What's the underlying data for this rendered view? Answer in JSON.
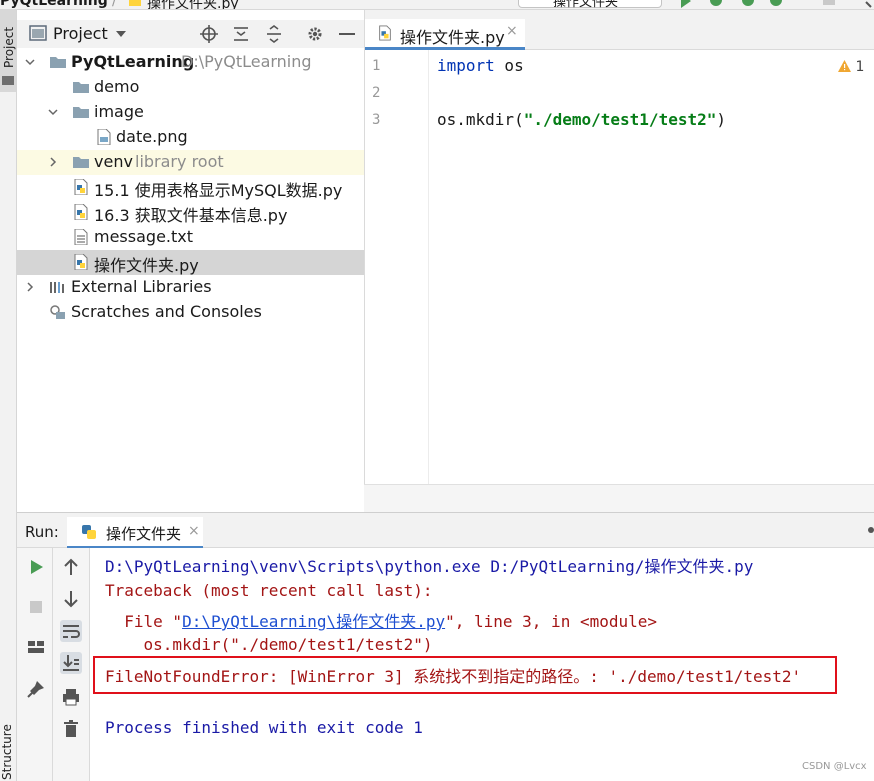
{
  "nav": {
    "root": "PyQtLearning",
    "separator": "/",
    "file": "操作文件夹.py",
    "run_config": "操作文件夹"
  },
  "left_strip": {
    "project": "Project",
    "structure": "Structure"
  },
  "project_panel": {
    "title": "Project",
    "tree": [
      {
        "label": "PyQtLearning",
        "sub": "D:\\PyQtLearning",
        "icon": "folder-icon"
      },
      {
        "label": "demo",
        "icon": "folder-icon"
      },
      {
        "label": "image",
        "icon": "folder-icon"
      },
      {
        "label": "date.png",
        "icon": "image-file-icon"
      },
      {
        "label": "venv",
        "sub": "library root",
        "icon": "folder-icon"
      },
      {
        "label": "15.1 使用表格显示MySQL数据.py",
        "icon": "python-file-icon"
      },
      {
        "label": "16.3 获取文件基本信息.py",
        "icon": "python-file-icon"
      },
      {
        "label": "message.txt",
        "icon": "text-file-icon"
      },
      {
        "label": "操作文件夹.py",
        "icon": "python-file-icon"
      },
      {
        "label": "External Libraries",
        "icon": "library-icon"
      },
      {
        "label": "Scratches and Consoles",
        "icon": "scratches-icon"
      }
    ]
  },
  "editor": {
    "tab": "操作文件夹.py",
    "tab_close": "×",
    "line_numbers": [
      "1",
      "2",
      "3"
    ],
    "line1_kw": "import",
    "line1_rest": " os",
    "line3_pre": "os.mkdir(",
    "line3_str": "\"./demo/test1/test2\"",
    "line3_post": ")",
    "warning_count": "1"
  },
  "run": {
    "label": "Run:",
    "tab": "操作文件夹",
    "tab_close": "×",
    "console": {
      "cmd": "D:\\PyQtLearning\\venv\\Scripts\\python.exe D:/PyQtLearning/操作文件夹.py",
      "traceback": "Traceback (most recent call last):",
      "file_pre": "  File \"",
      "file_link": "D:\\PyQtLearning\\操作文件夹.py",
      "file_post": "\", line 3, in <module>",
      "code": "    os.mkdir(\"./demo/test1/test2\")",
      "error": "FileNotFoundError: [WinError 3] 系统找不到指定的路径。: './demo/test1/test2'",
      "finished": "Process finished with exit code 1"
    }
  },
  "watermark": "CSDN @Lvcx",
  "colors": {
    "keyword": "#0033b3",
    "string": "#067d17",
    "console_blue": "#1a1aa6",
    "console_red": "#a31515",
    "error_box": "#e0101a",
    "selection": "#d5d5d5",
    "venv_row": "#fcfae3"
  }
}
